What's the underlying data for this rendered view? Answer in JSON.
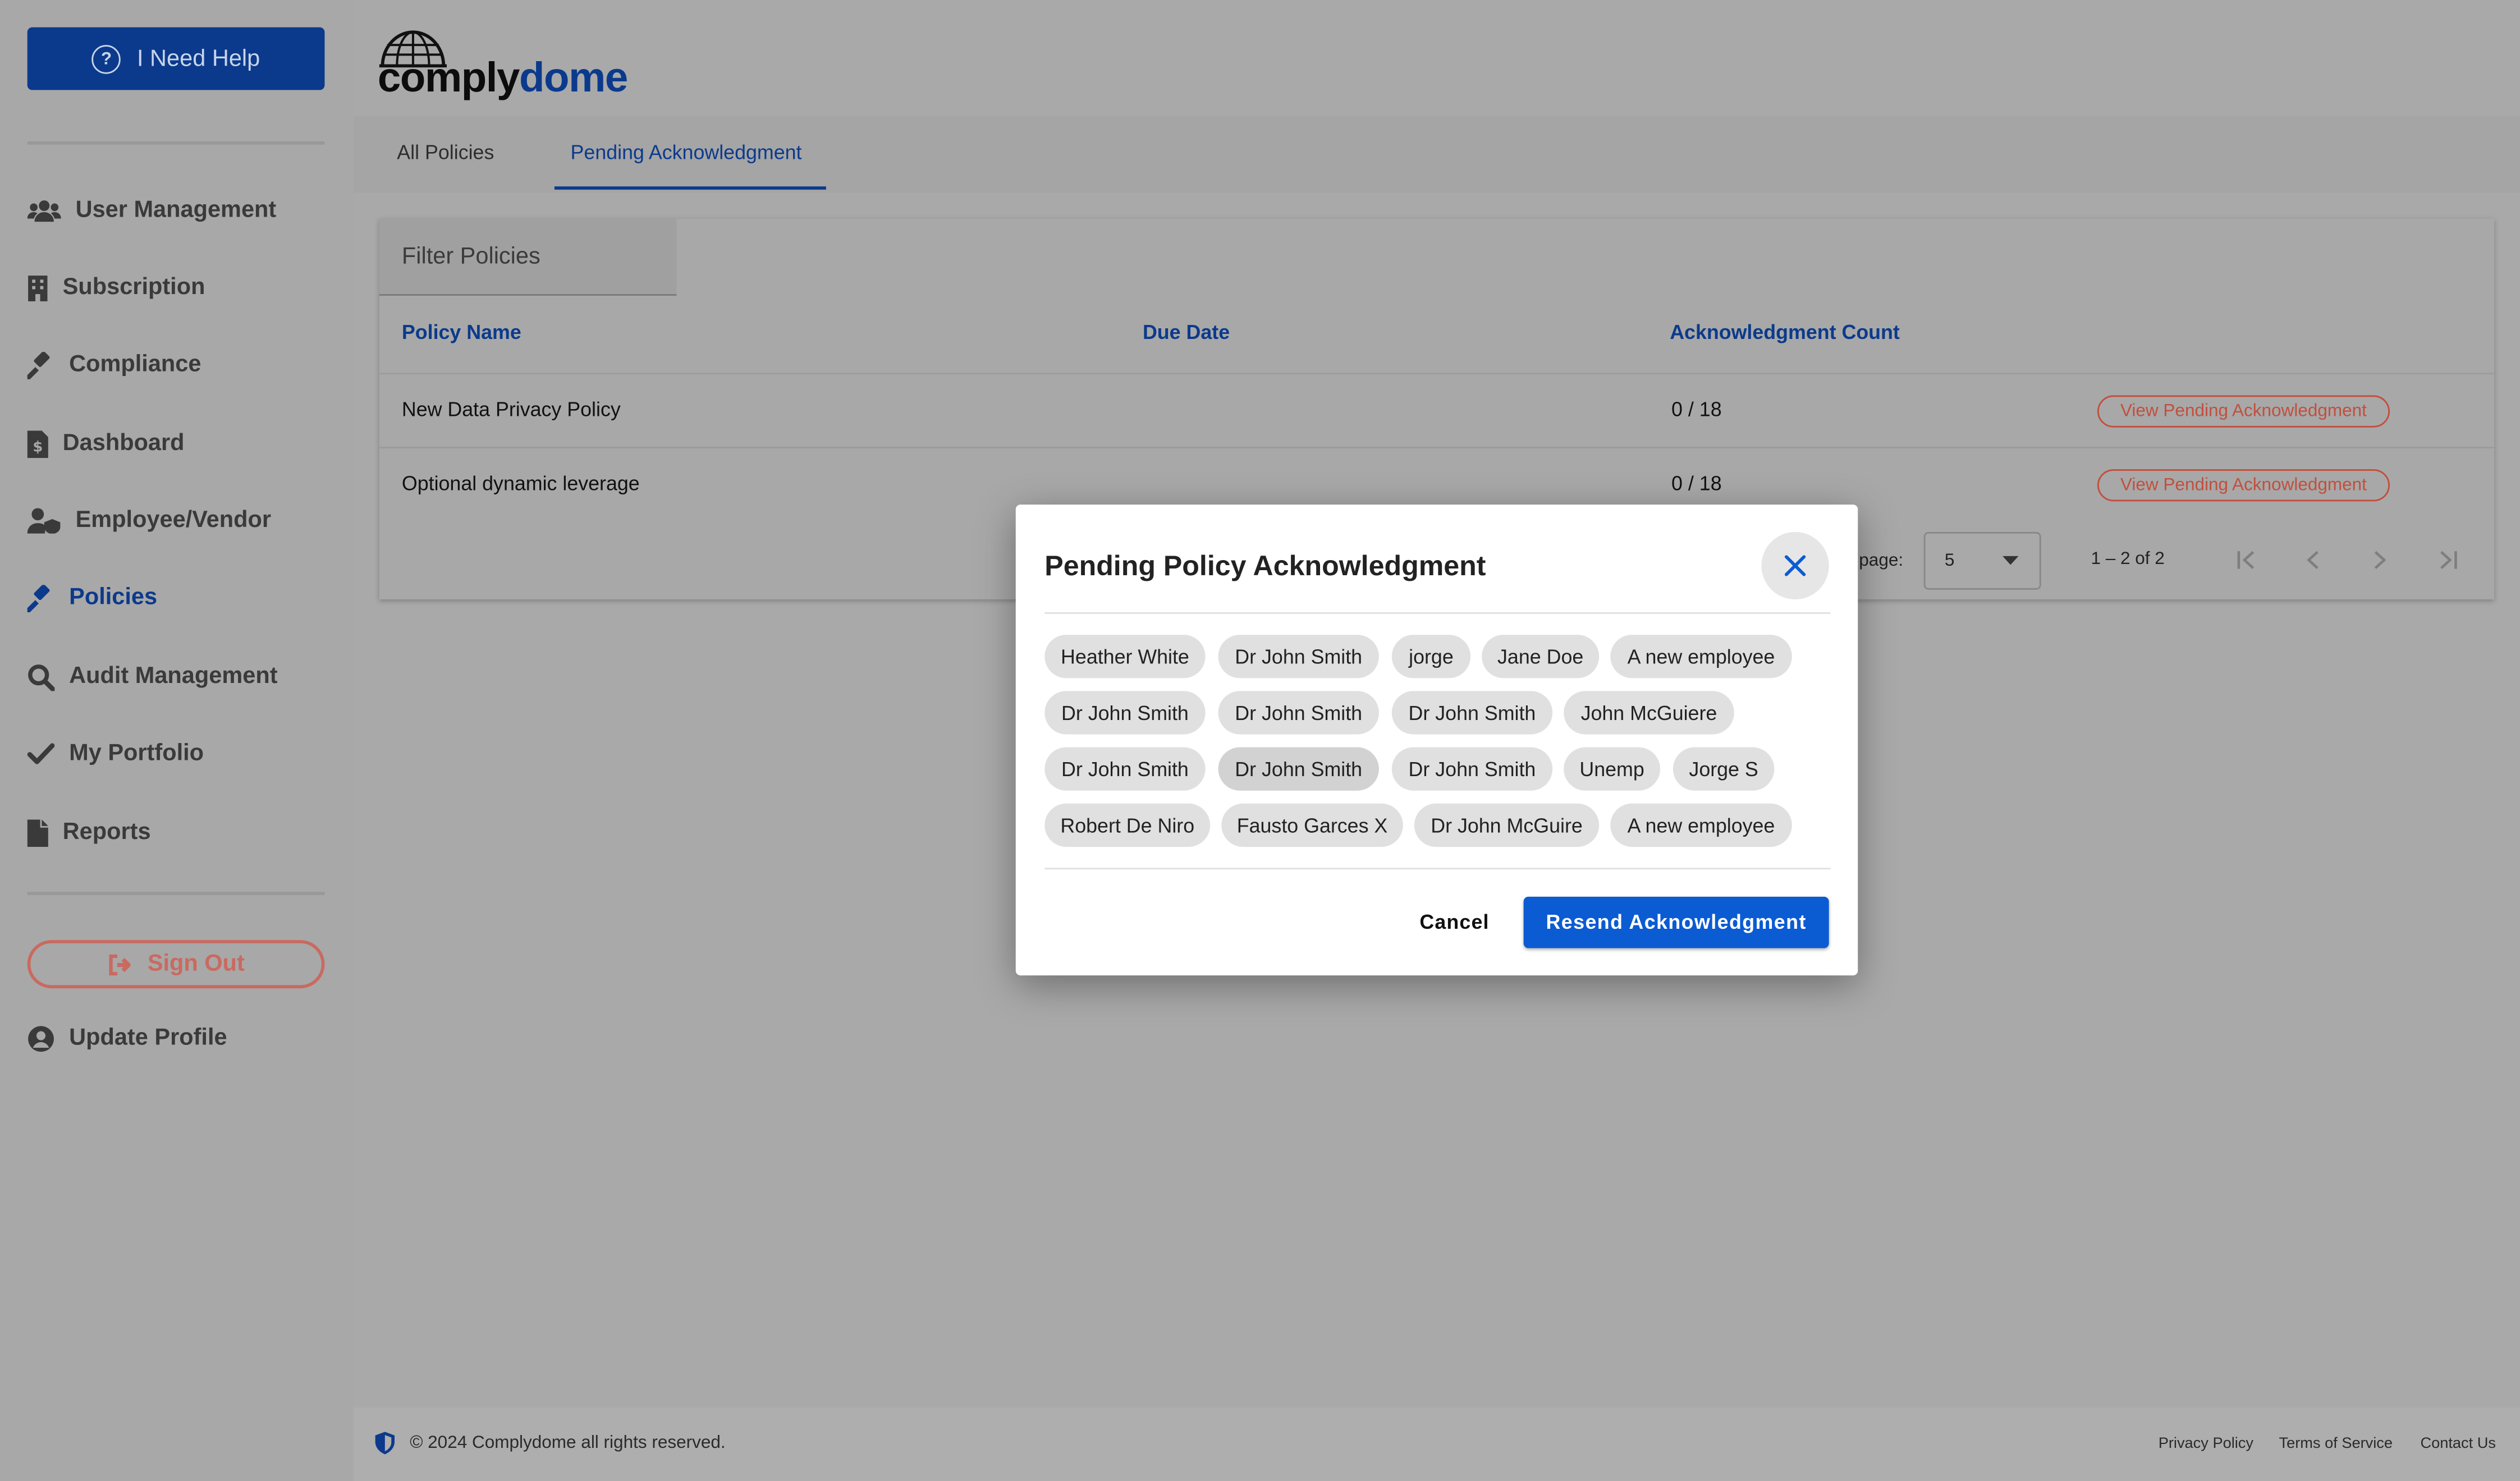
{
  "sidebar": {
    "help_label": "I Need Help",
    "items": [
      {
        "label": "User Management",
        "icon": "users-icon"
      },
      {
        "label": "Subscription",
        "icon": "building-icon"
      },
      {
        "label": "Compliance",
        "icon": "gavel-icon"
      },
      {
        "label": "Dashboard",
        "icon": "file-dollar-icon"
      },
      {
        "label": "Employee/Vendor",
        "icon": "user-shield-icon"
      },
      {
        "label": "Policies",
        "icon": "gavel-icon"
      },
      {
        "label": "Audit Management",
        "icon": "search-icon"
      },
      {
        "label": "My Portfolio",
        "icon": "check-icon"
      },
      {
        "label": "Reports",
        "icon": "file-icon"
      }
    ],
    "signout_label": "Sign Out",
    "update_profile_label": "Update Profile",
    "active_color": "#0b3a8c"
  },
  "logo": {
    "part1": "comply",
    "part2": "dome"
  },
  "tabs": [
    {
      "label": "All Policies"
    },
    {
      "label": "Pending Acknowledgment"
    }
  ],
  "filter": {
    "placeholder": "Filter Policies"
  },
  "table": {
    "headers": [
      "Policy Name",
      "Due Date",
      "Acknowledgment Count"
    ],
    "rows": [
      {
        "name": "New Data Privacy Policy",
        "due": "",
        "count": "0 / 18",
        "action": "View Pending Acknowledgment"
      },
      {
        "name": "Optional dynamic leverage",
        "due": "",
        "count": "0 / 18",
        "action": "View Pending Acknowledgment"
      }
    ]
  },
  "pagination": {
    "per_page_label": "r page:",
    "per_page_value": "5",
    "range": "1 – 2 of 2"
  },
  "modal": {
    "title": "Pending Policy Acknowledgment",
    "chips": [
      [
        "Heather White",
        "Dr John Smith",
        "jorge",
        "Jane Doe",
        "A new employee"
      ],
      [
        "Dr John Smith",
        "Dr John Smith",
        "Dr John Smith",
        "John McGuiere"
      ],
      [
        "Dr John Smith",
        "Dr John Smith",
        "Dr John Smith",
        "Unemp",
        "Jorge S"
      ],
      [
        "Robert De Niro",
        "Fausto Garces X",
        "Dr John McGuire",
        "A new employee"
      ]
    ],
    "cancel_label": "Cancel",
    "resend_label": "Resend Acknowledgment",
    "accent": "#0b5bd3"
  },
  "footer": {
    "copyright": "© 2024 Complydome all rights reserved.",
    "links": [
      "Privacy Policy",
      "Terms of Service",
      "Contact Us"
    ]
  }
}
